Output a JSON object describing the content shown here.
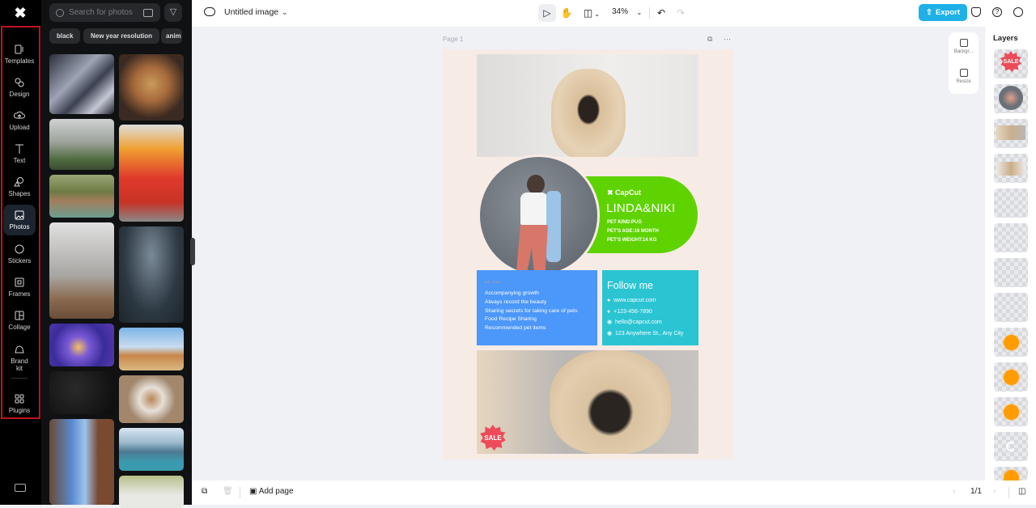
{
  "app": {
    "logo": "CapCut"
  },
  "rail": {
    "items": [
      {
        "label": "Templates",
        "icon": "templates-icon"
      },
      {
        "label": "Design",
        "icon": "design-icon"
      },
      {
        "label": "Upload",
        "icon": "upload-icon"
      },
      {
        "label": "Text",
        "icon": "text-icon"
      },
      {
        "label": "Shapes",
        "icon": "shapes-icon"
      },
      {
        "label": "Photos",
        "icon": "photos-icon",
        "active": true
      },
      {
        "label": "Stickers",
        "icon": "stickers-icon"
      },
      {
        "label": "Frames",
        "icon": "frames-icon"
      },
      {
        "label": "Collage",
        "icon": "collage-icon"
      },
      {
        "label": "Brand kit",
        "icon": "brand-kit-icon"
      },
      {
        "label": "Plugins",
        "icon": "plugins-icon"
      }
    ]
  },
  "panel": {
    "search_placeholder": "Search for photos",
    "chips": [
      "black",
      "New year resolution",
      "anim"
    ],
    "photos": [
      "Dark satin fabric",
      "Tacos on wooden board",
      "Monastery on cliff in fog",
      "Cosplayer in red costume",
      "Wooden bridge with prayer flags",
      "Misty forest path",
      "Man holding dollar banknote",
      "Candle in blue glass",
      "Stupas under blue sky",
      "Dark textured background",
      "Guinea pig",
      "European street",
      "Mountain lake with boat",
      "White fluffy puppy"
    ]
  },
  "topbar": {
    "title": "Untitled image",
    "zoom": "34%",
    "export_label": "Export"
  },
  "page": {
    "label": "Page 1",
    "brand": "CapCut",
    "name": "LINDA&NIKI",
    "pet_info": [
      "PET KIND:PUG",
      "PET'S AGE:16 MONTH",
      "PET'S WEIGHT:14 KG"
    ],
    "stars": "** ***",
    "list": [
      "Accompanying growth",
      "Always record the beauty",
      "Sharing secrets for taking care of pets",
      "Food Recipe Sharing",
      "Recommended pet items"
    ],
    "follow_title": "Follow me",
    "contacts": [
      "www.capcut.com",
      "+123-456-7890",
      "hello@capcut.com",
      "123 Anywhere St., Any City"
    ],
    "sale": "SALE"
  },
  "side_tools": [
    {
      "label": "Backgr..."
    },
    {
      "label": "Resize"
    }
  ],
  "layers": {
    "title": "Layers",
    "items": [
      "SALE sticker",
      "Woman circle photo",
      "Pug photo bottom",
      "Pug photo top",
      "Text layer",
      "Text layer",
      "Text layer",
      "Text layer",
      "Orange circle",
      "Orange circle",
      "Orange circle",
      "Loading layer",
      "Orange circle"
    ]
  },
  "bottombar": {
    "add_page": "Add page",
    "page_count": "1/1"
  },
  "colors": {
    "accent": "#1fb1e6",
    "green": "#5ed300",
    "blue": "#4c97fa",
    "teal": "#2ac4d3",
    "sale": "#ee4b5a",
    "rail_highlight": "#c0141e"
  }
}
